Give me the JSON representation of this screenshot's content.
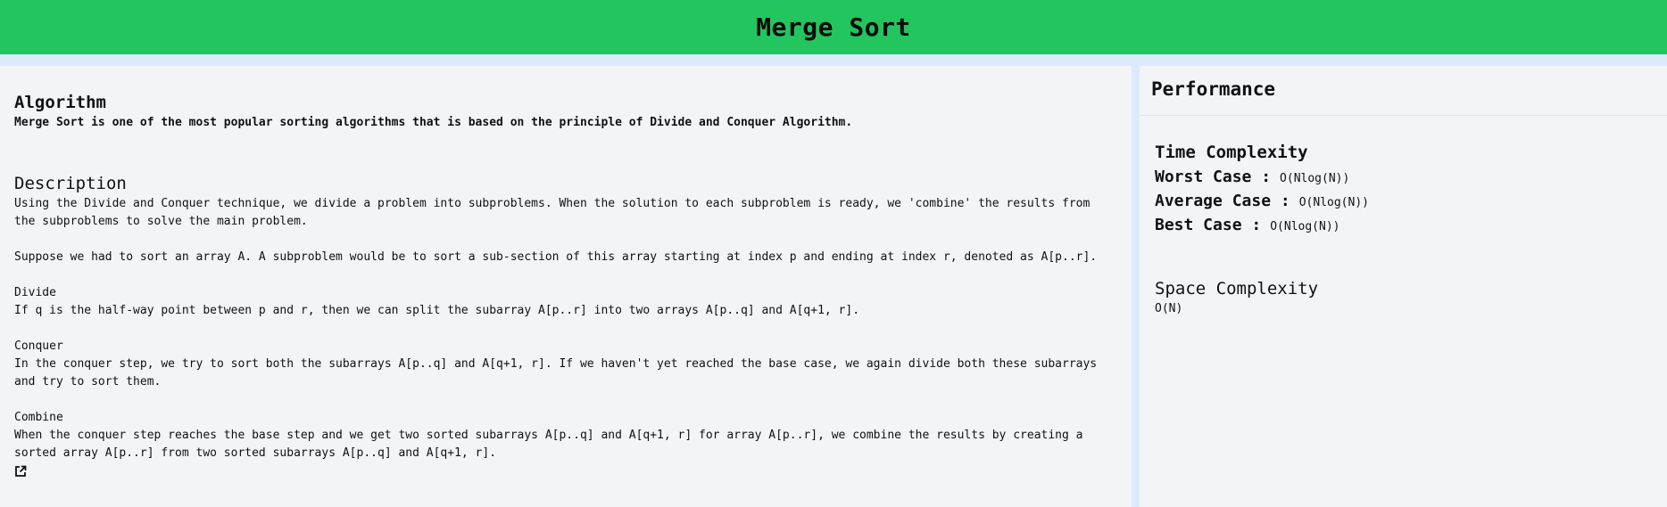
{
  "header": {
    "title": "Merge Sort"
  },
  "algorithm": {
    "title": "Algorithm",
    "text": "Merge Sort is one of the most popular sorting algorithms that is based on the principle of Divide and Conquer Algorithm."
  },
  "description": {
    "title": "Description",
    "p1": "Using the Divide and Conquer technique, we divide a problem into subproblems. When the solution to each subproblem is ready, we 'combine' the results from the subproblems to solve the main problem.",
    "p2": "Suppose we had to sort an array A. A subproblem would be to sort a sub-section of this array starting at index p and ending at index r, denoted as A[p..r].",
    "divide_label": "Divide",
    "divide_text": "If q is the half-way point between p and r, then we can split the subarray A[p..r] into two arrays A[p..q] and A[q+1, r].",
    "conquer_label": "Conquer",
    "conquer_text": "In the conquer step, we try to sort both the subarrays A[p..q] and A[q+1, r]. If we haven't yet reached the base case, we again divide both these subarrays and try to sort them.",
    "combine_label": "Combine",
    "combine_text": "When the conquer step reaches the base step and we get two sorted subarrays A[p..q] and A[q+1, r] for array A[p..r], we combine the results by creating a sorted array A[p..r] from two sorted subarrays A[p..q] and A[q+1, r]."
  },
  "performance": {
    "title": "Performance",
    "time_title": "Time Complexity",
    "worst_label": "Worst Case :",
    "worst_value": "O(Nlog(N))",
    "average_label": "Average Case :",
    "average_value": "O(Nlog(N))",
    "best_label": "Best Case :",
    "best_value": "O(Nlog(N))",
    "space_title": "Space Complexity",
    "space_value": "O(N)"
  },
  "icons": {
    "external_link": "external-link-icon"
  },
  "colors": {
    "header": "#22c55e",
    "page_bg": "#dbeafe",
    "panel_bg": "#f3f4f6"
  }
}
